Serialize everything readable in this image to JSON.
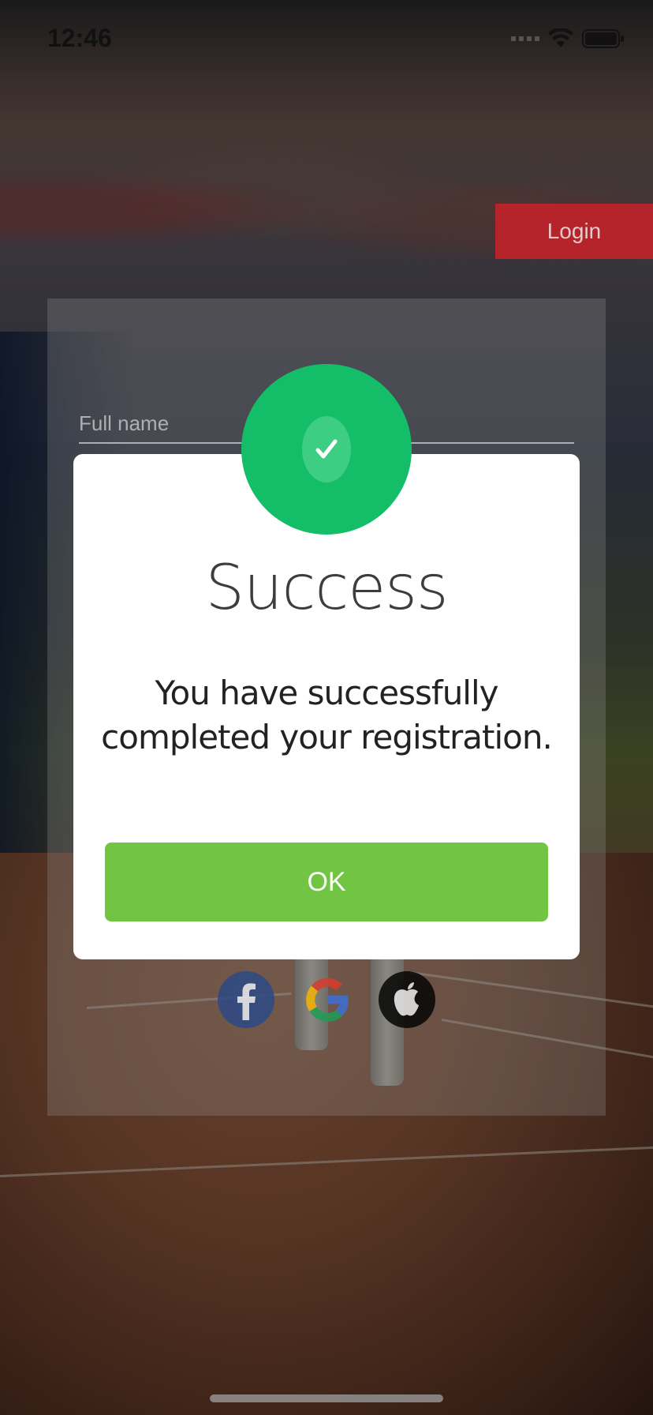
{
  "status_bar": {
    "time": "12:46"
  },
  "header": {
    "login_label": "Login"
  },
  "registration_form": {
    "full_name_placeholder": "Full name",
    "social_logins": [
      {
        "name": "facebook",
        "icon": "facebook-icon",
        "color": "#2c4a86"
      },
      {
        "name": "google",
        "icon": "google-icon"
      },
      {
        "name": "apple",
        "icon": "apple-icon",
        "color": "#050505"
      }
    ]
  },
  "success_modal": {
    "title": "Success",
    "message_line1": "You have successfully",
    "message_line2": "completed your registration.",
    "ok_label": "OK",
    "icon": "checkmark-icon",
    "badge_color": "#14be69",
    "button_color": "#72c443"
  },
  "colors": {
    "login_background": "#b5242a"
  }
}
